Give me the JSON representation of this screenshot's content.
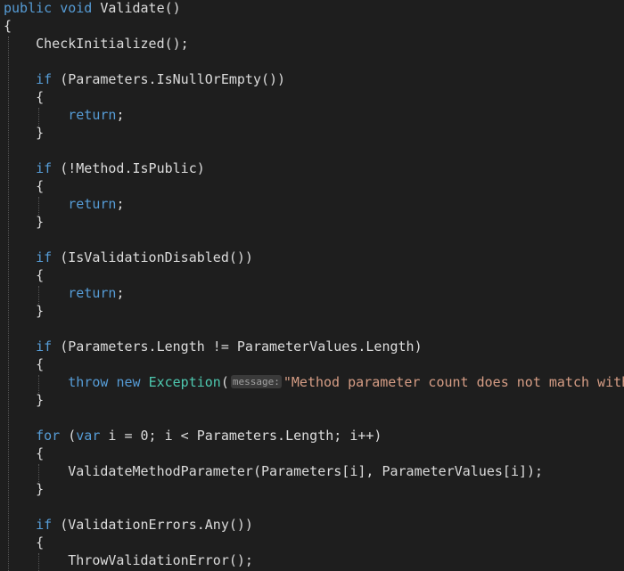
{
  "code": {
    "lines": [
      {
        "tokens": [
          [
            "kw",
            "public"
          ],
          [
            "id",
            " "
          ],
          [
            "kw",
            "void"
          ],
          [
            "id",
            " Validate()"
          ]
        ]
      },
      {
        "tokens": [
          [
            "id",
            "{"
          ]
        ]
      },
      {
        "tokens": [
          [
            "id",
            "    CheckInitialized();"
          ]
        ]
      },
      {
        "tokens": []
      },
      {
        "tokens": [
          [
            "id",
            "    "
          ],
          [
            "kw",
            "if"
          ],
          [
            "id",
            " (Parameters.IsNullOrEmpty())"
          ]
        ]
      },
      {
        "tokens": [
          [
            "id",
            "    {"
          ]
        ]
      },
      {
        "tokens": [
          [
            "id",
            "        "
          ],
          [
            "kw",
            "return"
          ],
          [
            "id",
            ";"
          ]
        ]
      },
      {
        "tokens": [
          [
            "id",
            "    }"
          ]
        ]
      },
      {
        "tokens": []
      },
      {
        "tokens": [
          [
            "id",
            "    "
          ],
          [
            "kw",
            "if"
          ],
          [
            "id",
            " (!Method.IsPublic)"
          ]
        ]
      },
      {
        "tokens": [
          [
            "id",
            "    {"
          ]
        ]
      },
      {
        "tokens": [
          [
            "id",
            "        "
          ],
          [
            "kw",
            "return"
          ],
          [
            "id",
            ";"
          ]
        ]
      },
      {
        "tokens": [
          [
            "id",
            "    }"
          ]
        ]
      },
      {
        "tokens": []
      },
      {
        "tokens": [
          [
            "id",
            "    "
          ],
          [
            "kw",
            "if"
          ],
          [
            "id",
            " (IsValidationDisabled())"
          ]
        ]
      },
      {
        "tokens": [
          [
            "id",
            "    {"
          ]
        ]
      },
      {
        "tokens": [
          [
            "id",
            "        "
          ],
          [
            "kw",
            "return"
          ],
          [
            "id",
            ";"
          ]
        ]
      },
      {
        "tokens": [
          [
            "id",
            "    }"
          ]
        ]
      },
      {
        "tokens": []
      },
      {
        "tokens": [
          [
            "id",
            "    "
          ],
          [
            "kw",
            "if"
          ],
          [
            "id",
            " (Parameters.Length != ParameterValues.Length)"
          ]
        ]
      },
      {
        "tokens": [
          [
            "id",
            "    {"
          ]
        ]
      },
      {
        "tokens": [
          [
            "id",
            "        "
          ],
          [
            "kw",
            "throw"
          ],
          [
            "id",
            " "
          ],
          [
            "kw",
            "new"
          ],
          [
            "id",
            " "
          ],
          [
            "type",
            "Exception"
          ],
          [
            "id",
            "("
          ],
          [
            "hint",
            "message:"
          ],
          [
            "str",
            "\"Method parameter count does not match with"
          ]
        ]
      },
      {
        "tokens": [
          [
            "id",
            "    }"
          ]
        ]
      },
      {
        "tokens": []
      },
      {
        "tokens": [
          [
            "id",
            "    "
          ],
          [
            "kw",
            "for"
          ],
          [
            "id",
            " ("
          ],
          [
            "kw",
            "var"
          ],
          [
            "id",
            " i = 0; i < Parameters.Length; i++)"
          ]
        ]
      },
      {
        "tokens": [
          [
            "id",
            "    {"
          ]
        ]
      },
      {
        "tokens": [
          [
            "id",
            "        ValidateMethodParameter(Parameters[i], ParameterValues[i]);"
          ]
        ]
      },
      {
        "tokens": [
          [
            "id",
            "    }"
          ]
        ]
      },
      {
        "tokens": []
      },
      {
        "tokens": [
          [
            "id",
            "    "
          ],
          [
            "kw",
            "if"
          ],
          [
            "id",
            " (ValidationErrors.Any())"
          ]
        ]
      },
      {
        "tokens": [
          [
            "id",
            "    {"
          ]
        ]
      },
      {
        "tokens": [
          [
            "id",
            "        ThrowValidationError();"
          ]
        ]
      }
    ]
  },
  "colors": {
    "background": "#1e1e1e",
    "keyword": "#569cd6",
    "type": "#4ec9b0",
    "string": "#d69d85",
    "identifier": "#dcdcdc"
  }
}
